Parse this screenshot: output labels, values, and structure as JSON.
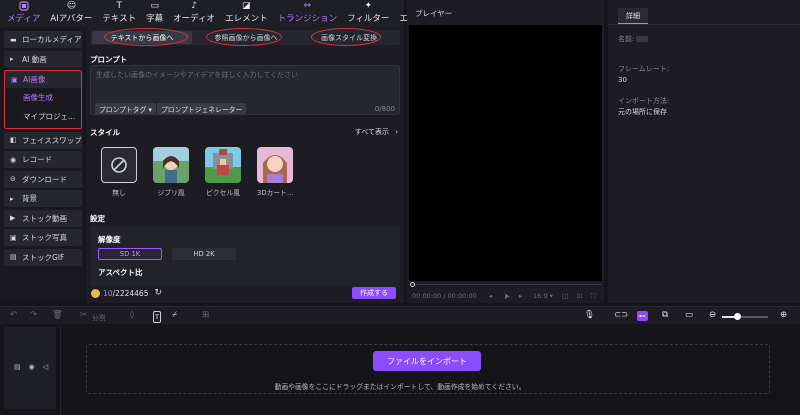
{
  "toolbar": {
    "items": [
      {
        "label": "メディア",
        "icon": "media-icon"
      },
      {
        "label": "AIアバター",
        "icon": "avatar-icon"
      },
      {
        "label": "テキスト",
        "icon": "text-icon"
      },
      {
        "label": "字幕",
        "icon": "subtitle-icon"
      },
      {
        "label": "オーディオ",
        "icon": "audio-icon"
      },
      {
        "label": "エレメント",
        "icon": "element-icon"
      },
      {
        "label": "トランジション",
        "icon": "transition-icon"
      },
      {
        "label": "フィルター",
        "icon": "filter-icon"
      },
      {
        "label": "エフェクト",
        "icon": "effect-icon"
      }
    ],
    "active_color": "#b77cff"
  },
  "sidebar": {
    "local_media": "ローカルメディア",
    "ai_video": "AI 動画",
    "ai_image": "AI画像",
    "ai_image_sub": [
      "画像生成",
      "マイプロジェ..."
    ],
    "others": [
      "フェイススワップ",
      "レコード",
      "ダウンロード",
      "背景",
      "ストック動画",
      "ストック写真",
      "ストックGIF"
    ]
  },
  "main": {
    "tabs": [
      "テキストから画像へ",
      "参照画像から画像へ",
      "画像スタイル変換"
    ],
    "prompt_label": "プロンプト",
    "prompt_placeholder": "生成したい画像のイメージやアイデアを詳しく入力してください",
    "prompt_tag_button": "プロンプトタグ ▾",
    "prompt_generator_button": "プロンプトジェネレーター",
    "char_count": "0/800",
    "style_label": "スタイル",
    "show_all": "すべて表示",
    "styles": [
      "無し",
      "ジブリ風",
      "ピクセル風",
      "3Dカート..."
    ],
    "settings_label": "設定",
    "resolution_label": "解像度",
    "resolution_options": [
      "SD 1K",
      "HD 2K"
    ],
    "aspect_label": "アスペクト比",
    "credits_current": "10",
    "credits_total": "/2224465",
    "create_button": "作成する",
    "accent": "#8a4dff"
  },
  "player": {
    "title": "プレイヤー",
    "time_current": "00:00:00",
    "time_total": "/ 00:00:00",
    "aspect": "16:9"
  },
  "details": {
    "tab": "詳細",
    "name_label": "名前:",
    "framerate_label": "フレームレート:",
    "framerate_value": "30",
    "import_label": "インポート方法:",
    "import_value": "元の場所に保存"
  },
  "timeline": {
    "split_label": "分割",
    "import_button": "ファイルをインポート",
    "drop_hint": "動画や画像をここにドラッグまたはインポートして、動画作成を始めてください。"
  }
}
